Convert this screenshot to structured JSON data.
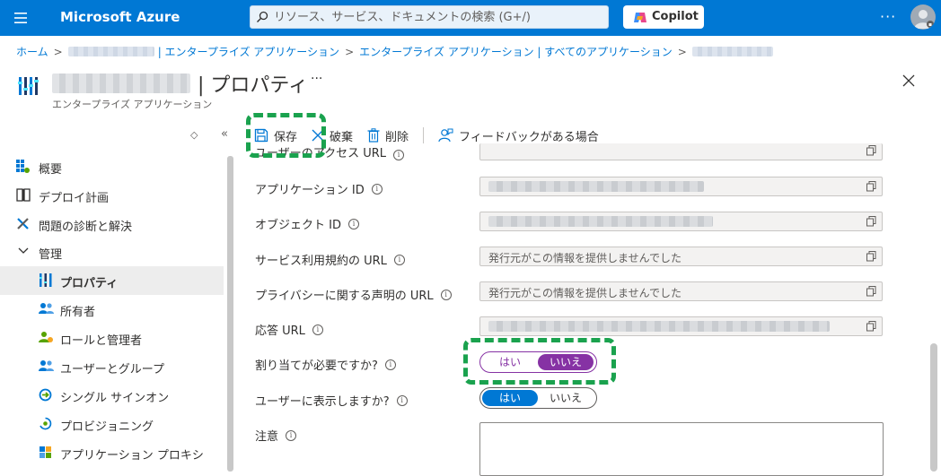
{
  "topbar": {
    "brand": "Microsoft Azure",
    "search_placeholder": "リソース、サービス、ドキュメントの検索 (G+/)",
    "copilot_label": "Copilot",
    "more": "···"
  },
  "breadcrumb": {
    "home": "ホーム",
    "item2_suffix": "| エンタープライズ アプリケーション",
    "item3": "エンタープライズ アプリケーション | すべてのアプリケーション"
  },
  "header": {
    "title": "| プロパティ",
    "more": "···",
    "subtitle": "エンタープライズ アプリケーション"
  },
  "nav": {
    "items": [
      {
        "label": "概要",
        "icon": "overview-grid-icon"
      },
      {
        "label": "デプロイ計画",
        "icon": "book-icon"
      },
      {
        "label": "問題の診断と解決",
        "icon": "wrench-icon"
      },
      {
        "label": "管理",
        "icon": "chevron-down-icon"
      },
      {
        "label": "プロパティ",
        "icon": "properties-bars-icon"
      },
      {
        "label": "所有者",
        "icon": "users-icon"
      },
      {
        "label": "ロールと管理者",
        "icon": "role-admin-icon"
      },
      {
        "label": "ユーザーとグループ",
        "icon": "users-groups-icon"
      },
      {
        "label": "シングル サインオン",
        "icon": "sso-icon"
      },
      {
        "label": "プロビジョニング",
        "icon": "provisioning-icon"
      },
      {
        "label": "アプリケーション プロキシ",
        "icon": "app-proxy-icon"
      }
    ]
  },
  "toolbar": {
    "save": "保存",
    "discard": "破棄",
    "delete": "削除",
    "feedback": "フィードバックがある場合"
  },
  "form": {
    "access_url_label": "ユーザーのアクセス URL",
    "app_id_label": "アプリケーション ID",
    "object_id_label": "オブジェクト ID",
    "tos_label": "サービス利用規約の URL",
    "tos_value": "発行元がこの情報を提供しませんでした",
    "privacy_label": "プライバシーに関する声明の URL",
    "privacy_value": "発行元がこの情報を提供しませんでした",
    "reply_url_label": "応答 URL",
    "assignment_label": "割り当てが必要ですか?",
    "assignment_yes": "はい",
    "assignment_no": "いいえ",
    "assignment_selected": "いいえ",
    "visible_label": "ユーザーに表示しますか?",
    "visible_yes": "はい",
    "visible_no": "いいえ",
    "visible_selected": "はい",
    "notes_label": "注意",
    "notes_value": ""
  },
  "colors": {
    "azure_blue": "#0078d4",
    "toggle_purple": "#8632a4",
    "highlight_green": "#1aa24e"
  }
}
